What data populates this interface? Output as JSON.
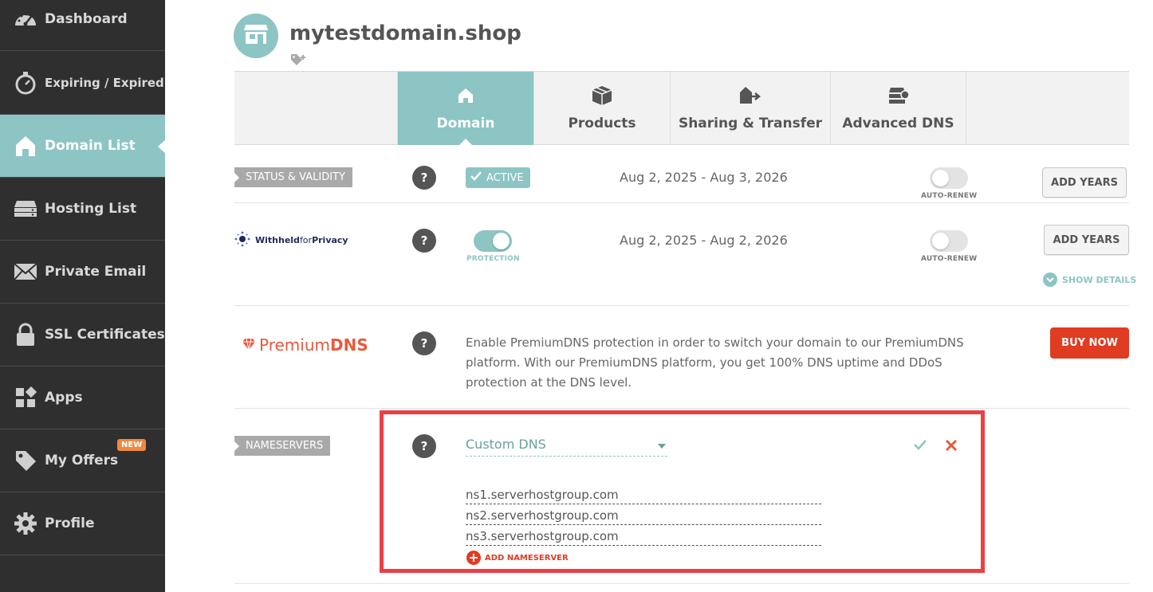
{
  "sidebar": {
    "items": [
      {
        "label": "Dashboard",
        "icon": "gauge-icon"
      },
      {
        "label": "Expiring / Expired",
        "icon": "stopwatch-icon"
      },
      {
        "label": "Domain List",
        "icon": "home-icon",
        "active": true
      },
      {
        "label": "Hosting List",
        "icon": "server-icon"
      },
      {
        "label": "Private Email",
        "icon": "envelope-icon"
      },
      {
        "label": "SSL Certificates",
        "icon": "lock-icon"
      },
      {
        "label": "Apps",
        "icon": "apps-icon"
      },
      {
        "label": "My Offers",
        "icon": "tag-icon",
        "badge": "NEW"
      },
      {
        "label": "Profile",
        "icon": "gear-icon"
      }
    ]
  },
  "header": {
    "domain": "mytestdomain.shop"
  },
  "tabs": [
    {
      "label": "Domain",
      "icon": "home-icon",
      "active": true
    },
    {
      "label": "Products",
      "icon": "box-icon"
    },
    {
      "label": "Sharing & Transfer",
      "icon": "transfer-icon"
    },
    {
      "label": "Advanced DNS",
      "icon": "dns-icon"
    }
  ],
  "status": {
    "label": "STATUS & VALIDITY",
    "help": "?",
    "badge": "ACTIVE",
    "dates": "Aug 2, 2025 - Aug 3, 2026",
    "autorenew_label": "AUTO-RENEW",
    "autorenew_on": false,
    "add_years": "ADD YEARS"
  },
  "privacy": {
    "logo_text_a": "Withheld",
    "logo_text_b": "for",
    "logo_text_c": "Privacy",
    "help": "?",
    "protection_label": "PROTECTION",
    "protection_on": true,
    "dates": "Aug 2, 2025 - Aug 2, 2026",
    "autorenew_label": "AUTO-RENEW",
    "autorenew_on": false,
    "add_years": "ADD YEARS",
    "show_details": "SHOW DETAILS"
  },
  "premium_dns": {
    "logo_a": "Premium",
    "logo_b": "DNS",
    "help": "?",
    "description": "Enable PremiumDNS protection in order to switch your domain to our PremiumDNS platform. With our PremiumDNS platform, you get 100% DNS uptime and DDoS protection at the DNS level.",
    "buy_now": "BUY NOW"
  },
  "nameservers": {
    "label": "NAMESERVERS",
    "help": "?",
    "selected": "Custom DNS",
    "entries": [
      "ns1.serverhostgroup.com",
      "ns2.serverhostgroup.com",
      "ns3.serverhostgroup.com"
    ],
    "add_label": "ADD NAMESERVER"
  },
  "colors": {
    "accent": "#8cc5c3",
    "sidebar_bg": "#2f2f2f",
    "danger": "#e03c22",
    "highlight": "#ec3f46"
  }
}
